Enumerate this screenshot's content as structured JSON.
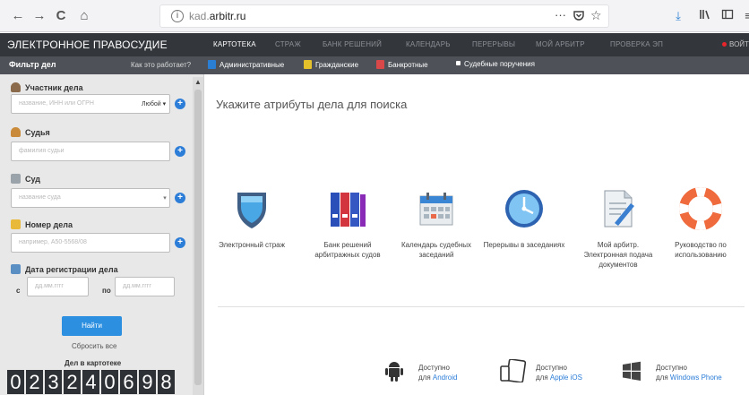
{
  "browser": {
    "url_domain": "kad.",
    "url_host": "arbitr.ru",
    "menu_dots": "···",
    "back": "←",
    "forward": "→",
    "reload": "C",
    "home": "⌂"
  },
  "header": {
    "brand": "ЭЛЕКТРОННОЕ ПРАВОСУДИЕ",
    "tabs": [
      "КАРТОТЕКА",
      "СТРАЖ",
      "БАНК РЕШЕНИЙ",
      "КАЛЕНДАРЬ",
      "ПЕРЕРЫВЫ",
      "МОЙ АРБИТР",
      "ПРОВЕРКА ЭП"
    ],
    "login": "ВОЙТ"
  },
  "filter": {
    "title": "Фильтр дел",
    "how_it_works": "Как это работает?",
    "categories": [
      "Административные",
      "Гражданские",
      "Банкротные",
      "Судебные поручения"
    ],
    "category_colors": [
      "#2a7fd4",
      "#e4c02a",
      "#d94848",
      "#ffffff"
    ]
  },
  "sidebar": {
    "participant": {
      "label": "Участник дела",
      "placeholder": "название, ИНН или ОГРН",
      "select": "Любой ▾"
    },
    "judge": {
      "label": "Судья",
      "placeholder": "фамилия судьи"
    },
    "court": {
      "label": "Суд",
      "placeholder": "название суда",
      "arrow": "▾"
    },
    "case_number": {
      "label": "Номер дела",
      "placeholder": "например, А50-5568/08"
    },
    "reg_date": {
      "label": "Дата регистрации дела",
      "from_label": "с",
      "to_label": "по",
      "placeholder": "дд.мм.гггг"
    },
    "search_button": "Найти",
    "reset": "Сбросить все",
    "cases_label": "Дел в картотеке",
    "counter": [
      "0",
      "2",
      "3",
      "2",
      "4",
      "0",
      "6",
      "9",
      "8"
    ]
  },
  "main": {
    "title": "Укажите атрибуты дела для поиска",
    "services": [
      {
        "label": "Электронный страж",
        "icon": "shield-icon"
      },
      {
        "label": "Банк решений арбитражных судов",
        "icon": "binders-icon"
      },
      {
        "label": "Календарь судебных заседаний",
        "icon": "calendar-icon"
      },
      {
        "label": "Перерывы в заседаниях",
        "icon": "clock-icon"
      },
      {
        "label": "Мой арбитр. Электронная подача документов",
        "icon": "document-icon"
      },
      {
        "label": "Руководство по использованию",
        "icon": "lifebuoy-icon"
      }
    ],
    "apps": [
      {
        "available": "Доступно",
        "prefix": "для ",
        "platform": "Android"
      },
      {
        "available": "Доступно",
        "prefix": "для ",
        "platform": "Apple iOS"
      },
      {
        "available": "Доступно",
        "prefix": "для ",
        "platform": "Windows Phone"
      }
    ]
  }
}
